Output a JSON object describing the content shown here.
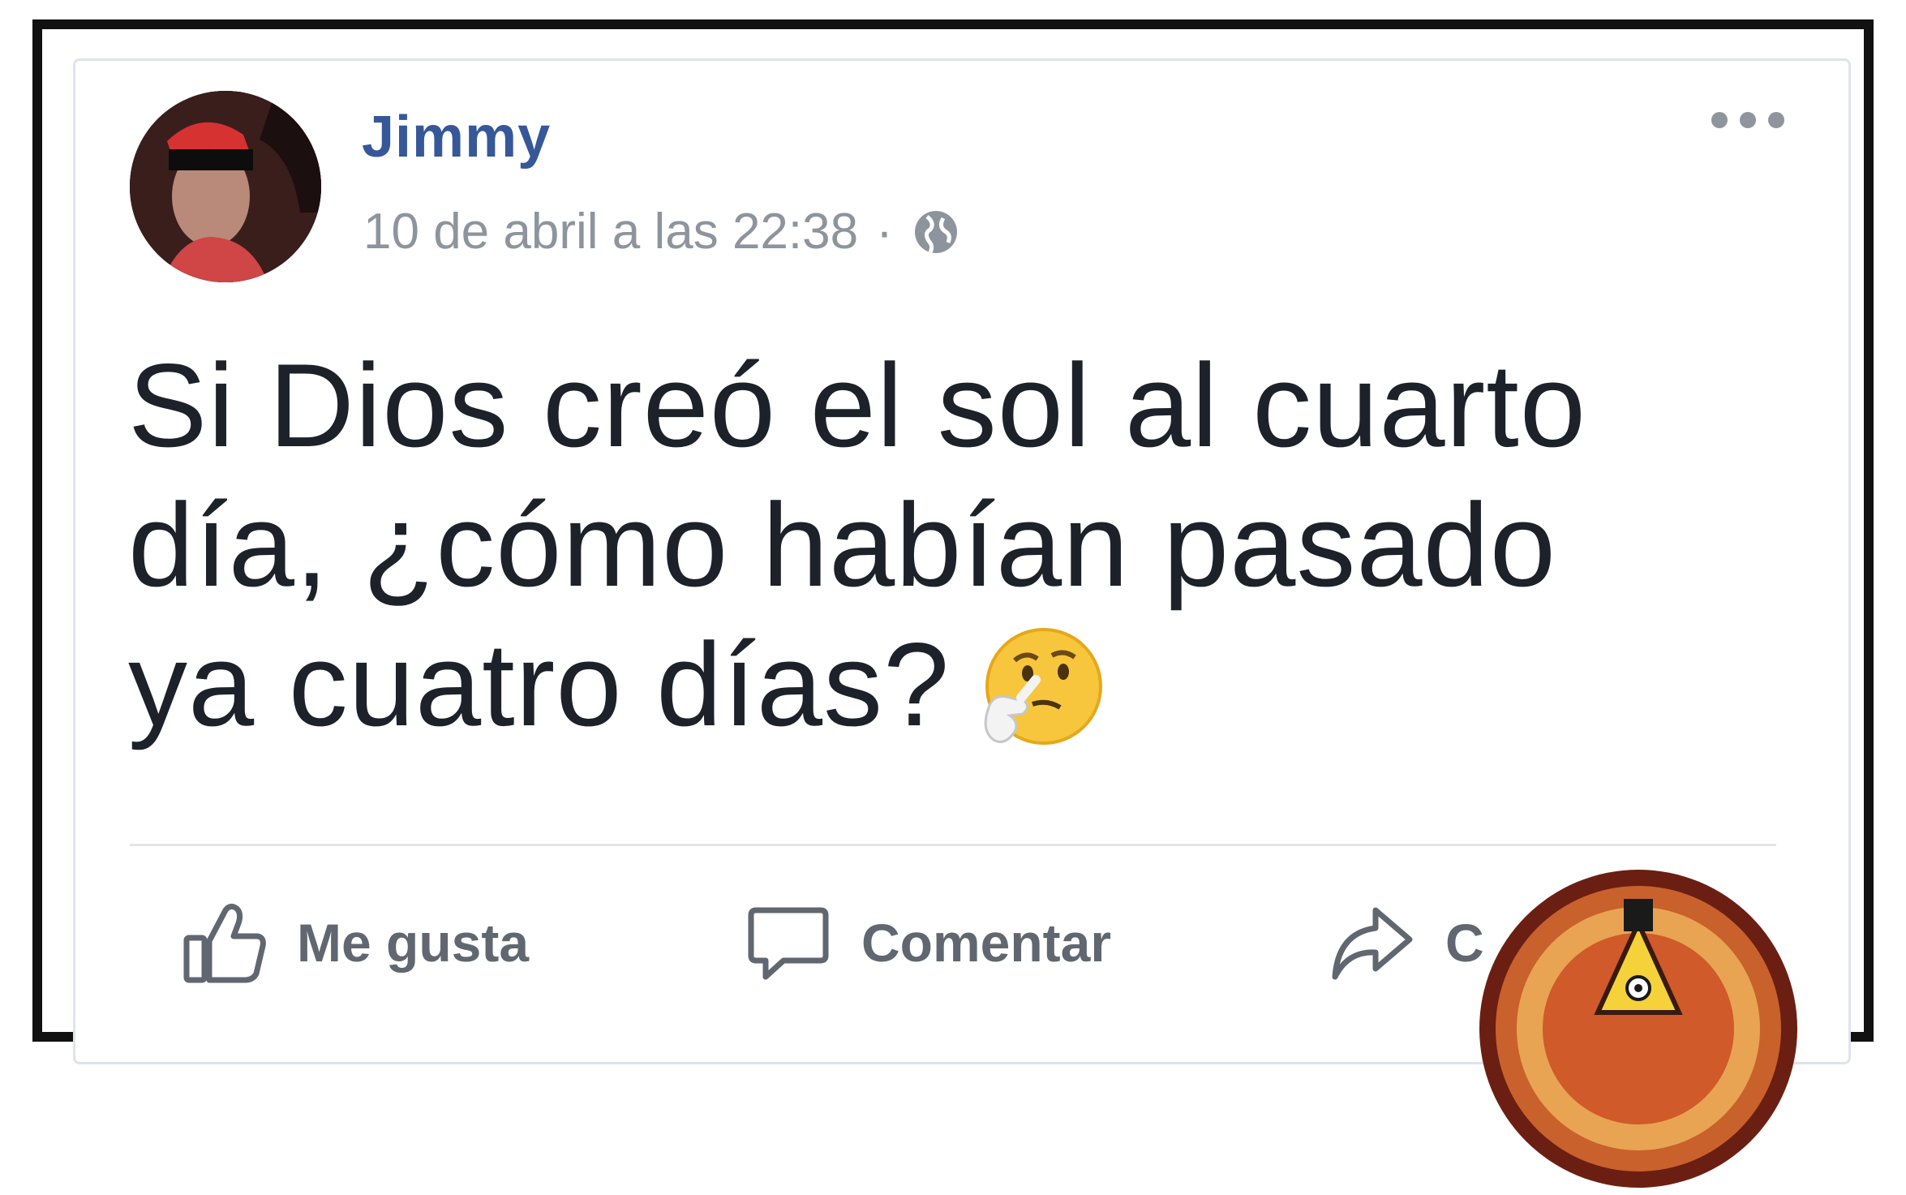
{
  "post": {
    "author": "Jimmy",
    "timestamp": "10 de abril a las 22:38",
    "separator": "·",
    "privacy_icon": "globe-icon",
    "lines": [
      "Si Dios creó el sol al cuarto",
      "día, ¿cómo habían pasado",
      "ya cuatro días?"
    ],
    "emoji": "thinking-face-emoji"
  },
  "actions": {
    "like_label": "Me gusta",
    "comment_label": "Comentar",
    "share_label": "C"
  },
  "colors": {
    "author": "#365899",
    "meta": "#8d949e",
    "text": "#1d2129",
    "action": "#606770",
    "frame": "#111111"
  }
}
